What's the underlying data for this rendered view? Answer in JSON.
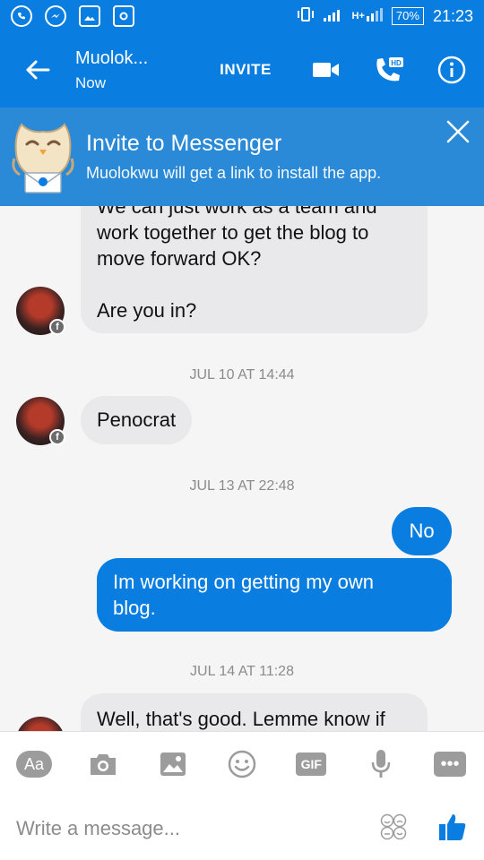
{
  "status_bar": {
    "battery": "70%",
    "time": "21:23",
    "network": "H+",
    "notification_icons": [
      "whatsapp-icon",
      "messenger-icon",
      "gallery-icon",
      "instagram-icon"
    ]
  },
  "header": {
    "contact_name": "Muolok...",
    "contact_status": "Now",
    "invite_label": "INVITE",
    "hd_label": "HD",
    "accent": "#0a7de0"
  },
  "banner": {
    "title": "Invite to Messenger",
    "subtitle": "Muolokwu will get a link to install the app."
  },
  "messages": [
    {
      "from": "them",
      "lines": [
        "We can just work as a team and",
        "work together to get the blog to",
        "move forward OK?",
        "",
        "Are you in?"
      ]
    },
    {
      "timestamp": "JUL 10 AT 14:44"
    },
    {
      "from": "them",
      "text": "Penocrat"
    },
    {
      "timestamp": "JUL 13 AT 22:48"
    },
    {
      "from": "me",
      "text": "No"
    },
    {
      "from": "me",
      "lines": [
        "Im working on getting my own",
        "blog."
      ]
    },
    {
      "timestamp": "JUL 14 AT 11:28"
    },
    {
      "from": "them",
      "lines": [
        "Well, that's good. Lemme know if"
      ]
    }
  ],
  "m1": {
    "l1": "We can just work as a team and",
    "l2": "work together to get the blog to",
    "l3": "move forward OK?",
    "l4": "Are you in?"
  },
  "ts1": "JUL 10 AT 14:44",
  "m2": "Penocrat",
  "ts2": "JUL 13 AT 22:48",
  "m3": "No",
  "m4": {
    "l1": "Im working on getting my own",
    "l2": "blog."
  },
  "ts3": "JUL 14 AT 11:28",
  "m5": "Well, that's good. Lemme know if",
  "composer": {
    "aa_label": "Aa",
    "gif_label": "GIF",
    "placeholder": "Write a message..."
  },
  "colors": {
    "outgoing_bubble": "#0a7de0",
    "incoming_bubble": "#e9e9eb",
    "like_icon": "#0a7de0"
  }
}
